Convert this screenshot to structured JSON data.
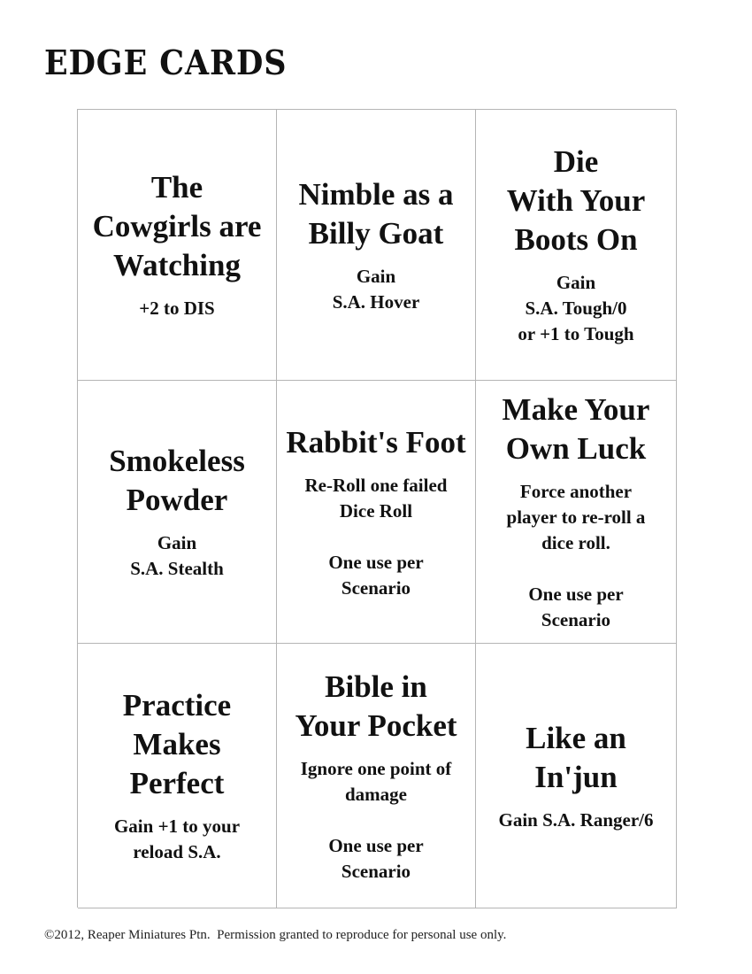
{
  "page": {
    "title": "EDGE CARDS",
    "footer": "©2012, Reaper Miniatures Ptn.  Permission granted to reproduce for personal use only."
  },
  "cards": [
    {
      "title": "The\nCowgirls are\nWatching",
      "text": "+2 to DIS"
    },
    {
      "title": "Nimble as a\nBilly Goat",
      "text": "Gain\nS.A.  Hover"
    },
    {
      "title": "Die\nWith Your\nBoots On",
      "text": "Gain\nS.A.  Tough/0\nor +1 to Tough"
    },
    {
      "title": "Smokeless\nPowder",
      "text": "Gain\nS.A.  Stealth"
    },
    {
      "title": "Rabbit's Foot",
      "text": "Re-Roll one failed\nDice Roll\n\nOne use per\nScenario"
    },
    {
      "title": "Make Your\nOwn Luck",
      "text": "Force another\nplayer to re-roll a\ndice roll.\n\nOne use per\nScenario"
    },
    {
      "title": "Practice\nMakes\nPerfect",
      "text": "Gain +1 to your\nreload S.A."
    },
    {
      "title": "Bible in\nYour Pocket",
      "text": "Ignore one point of\ndamage\n\nOne use per\nScenario"
    },
    {
      "title": "Like an\nIn'jun",
      "text": "Gain S.A. Ranger/6"
    }
  ]
}
